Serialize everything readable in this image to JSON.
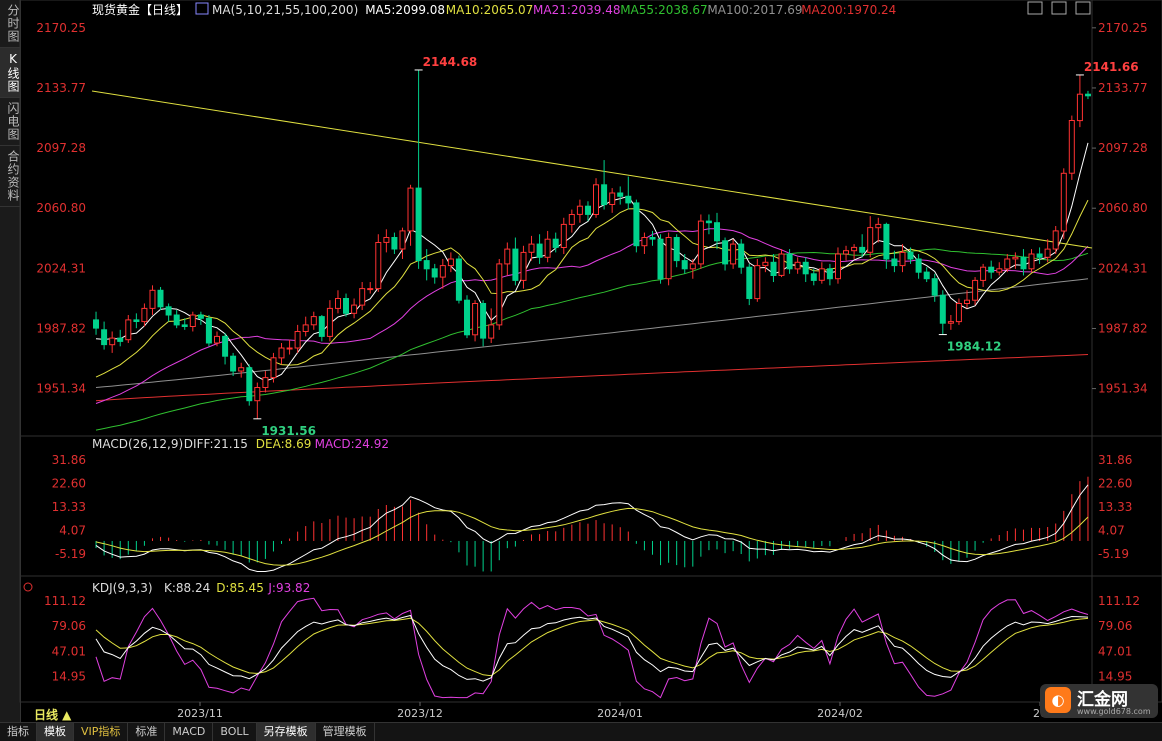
{
  "left_tabs": [
    "分时图",
    "K线图",
    "闪电图",
    "合约资料"
  ],
  "active_left_tab": 1,
  "bottom_tabs": [
    "指标",
    "模板",
    "VIP指标",
    "标准",
    "MACD",
    "BOLL",
    "另存模板",
    "管理模板"
  ],
  "period_label": "日线 ▲",
  "logo": {
    "glyph": "◐",
    "text": "汇金网",
    "sub": "www.gold678.com"
  },
  "colors": {
    "up": "#ff3232",
    "down": "#00d28c",
    "ma5": "#ffffff",
    "ma10": "#e0e040",
    "ma21": "#e040e0",
    "ma55": "#30c030",
    "ma100": "#909090",
    "ma200": "#e03030",
    "trend": "#e0e040"
  },
  "chart_data": {
    "type": "candlestick",
    "title": "现货黄金【日线】",
    "x_ticks": [
      "2023/11",
      "2023/12",
      "2024/01",
      "2024/02",
      "20"
    ],
    "main": {
      "ylim": [
        1925,
        2175
      ],
      "ticks": [
        "2170.25",
        "2133.77",
        "2097.28",
        "2060.80",
        "2024.31",
        "1987.82",
        "1951.34"
      ],
      "legend": [
        {
          "text": "MA(5,10,21,55,100,200)",
          "color": "#dddddd"
        },
        {
          "text": "MA5:2099.08",
          "color": "#ffffff"
        },
        {
          "text": "MA10:2065.07",
          "color": "#e0e040"
        },
        {
          "text": "MA21:2039.48",
          "color": "#e040e0"
        },
        {
          "text": "MA55:2038.67",
          "color": "#30c030"
        },
        {
          "text": "MA100:2017.69",
          "color": "#909090"
        },
        {
          "text": "MA200:1970.24",
          "color": "#e03030"
        }
      ],
      "candles": [
        [
          1993,
          1988,
          1998,
          1984
        ],
        [
          1987,
          1978,
          1992,
          1975
        ],
        [
          1978,
          1982,
          1986,
          1973
        ],
        [
          1982,
          1980,
          1987,
          1977
        ],
        [
          1981,
          1993,
          1996,
          1979
        ],
        [
          1993,
          1992,
          1997,
          1988
        ],
        [
          1992,
          2000,
          2003,
          1989
        ],
        [
          2000,
          2011,
          2014,
          1996
        ],
        [
          2011,
          2001,
          2013,
          1999
        ],
        [
          2001,
          1996,
          2003,
          1992
        ],
        [
          1996,
          1990,
          1999,
          1988
        ],
        [
          1990,
          1989,
          1994,
          1987
        ],
        [
          1989,
          1996,
          1998,
          1986
        ],
        [
          1996,
          1994,
          1998,
          1990
        ],
        [
          1994,
          1979,
          1996,
          1977
        ],
        [
          1979,
          1983,
          1986,
          1977
        ],
        [
          1983,
          1971,
          1985,
          1966
        ],
        [
          1971,
          1962,
          1973,
          1959
        ],
        [
          1962,
          1964,
          1967,
          1958
        ],
        [
          1964,
          1944,
          1966,
          1941
        ],
        [
          1944,
          1952,
          1955,
          1933
        ],
        [
          1952,
          1958,
          1962,
          1949
        ],
        [
          1958,
          1970,
          1973,
          1955
        ],
        [
          1970,
          1976,
          1979,
          1966
        ],
        [
          1976,
          1976,
          1981,
          1972
        ],
        [
          1976,
          1986,
          1990,
          1973
        ],
        [
          1986,
          1990,
          1995,
          1983
        ],
        [
          1990,
          1995,
          1998,
          1987
        ],
        [
          1995,
          1983,
          1996,
          1980
        ],
        [
          1983,
          2000,
          2005,
          1980
        ],
        [
          2000,
          2006,
          2011,
          1997
        ],
        [
          2006,
          1997,
          2009,
          1995
        ],
        [
          1997,
          2002,
          2006,
          1994
        ],
        [
          2002,
          2012,
          2016,
          1999
        ],
        [
          2012,
          2012,
          2016,
          2009
        ],
        [
          2012,
          2040,
          2045,
          2010
        ],
        [
          2040,
          2043,
          2048,
          2034
        ],
        [
          2043,
          2036,
          2046,
          2033
        ],
        [
          2036,
          2047,
          2049,
          2030
        ],
        [
          2047,
          2073,
          2075,
          2038
        ],
        [
          2073,
          2029,
          2144.68,
          2024
        ],
        [
          2029,
          2024,
          2036,
          2017
        ],
        [
          2024,
          2019,
          2027,
          2015
        ],
        [
          2019,
          2026,
          2030,
          2012
        ],
        [
          2026,
          2030,
          2034,
          2022
        ],
        [
          2030,
          2005,
          2032,
          2003
        ],
        [
          2005,
          1984,
          2008,
          1982
        ],
        [
          1984,
          2003,
          2005,
          1980
        ],
        [
          2003,
          1982,
          2005,
          1977
        ],
        [
          1982,
          1990,
          2000,
          1979
        ],
        [
          1990,
          2027,
          2030,
          1987
        ],
        [
          2027,
          2036,
          2040,
          2020
        ],
        [
          2036,
          2017,
          2043,
          2014
        ],
        [
          2017,
          2034,
          2038,
          2012
        ],
        [
          2034,
          2039,
          2044,
          2029
        ],
        [
          2039,
          2031,
          2045,
          2027
        ],
        [
          2031,
          2042,
          2047,
          2028
        ],
        [
          2042,
          2037,
          2046,
          2034
        ],
        [
          2037,
          2051,
          2055,
          2033
        ],
        [
          2051,
          2057,
          2060,
          2046
        ],
        [
          2057,
          2062,
          2066,
          2052
        ],
        [
          2062,
          2057,
          2065,
          2053
        ],
        [
          2057,
          2075,
          2079,
          2055
        ],
        [
          2075,
          2063,
          2090,
          2060
        ],
        [
          2063,
          2070,
          2073,
          2058
        ],
        [
          2070,
          2068,
          2074,
          2063
        ],
        [
          2068,
          2064,
          2080,
          2060
        ],
        [
          2064,
          2038,
          2066,
          2034
        ],
        [
          2038,
          2043,
          2046,
          2033
        ],
        [
          2043,
          2042,
          2047,
          2038
        ],
        [
          2042,
          2018,
          2045,
          2015
        ],
        [
          2018,
          2043,
          2046,
          2014
        ],
        [
          2043,
          2029,
          2045,
          2025
        ],
        [
          2029,
          2024,
          2033,
          2021
        ],
        [
          2024,
          2027,
          2030,
          2018
        ],
        [
          2027,
          2053,
          2057,
          2024
        ],
        [
          2053,
          2052,
          2057,
          2045
        ],
        [
          2052,
          2041,
          2058,
          2036
        ],
        [
          2041,
          2027,
          2043,
          2023
        ],
        [
          2027,
          2039,
          2042,
          2024
        ],
        [
          2039,
          2025,
          2042,
          2021
        ],
        [
          2025,
          2006,
          2027,
          2002
        ],
        [
          2006,
          2026,
          2030,
          2004
        ],
        [
          2026,
          2028,
          2031,
          2022
        ],
        [
          2028,
          2020,
          2033,
          2016
        ],
        [
          2020,
          2033,
          2036,
          2019
        ],
        [
          2033,
          2024,
          2036,
          2021
        ],
        [
          2024,
          2028,
          2031,
          2021
        ],
        [
          2028,
          2021,
          2031,
          2016
        ],
        [
          2021,
          2017,
          2024,
          2014
        ],
        [
          2017,
          2024,
          2028,
          2015
        ],
        [
          2024,
          2018,
          2027,
          2014
        ],
        [
          2018,
          2033,
          2037,
          2015
        ],
        [
          2033,
          2035,
          2038,
          2029
        ],
        [
          2035,
          2037,
          2039,
          2030
        ],
        [
          2037,
          2034,
          2045,
          2031
        ],
        [
          2034,
          2049,
          2056,
          2031
        ],
        [
          2049,
          2051,
          2055,
          2040
        ],
        [
          2051,
          2030,
          2052,
          2024
        ],
        [
          2030,
          2026,
          2035,
          2022
        ],
        [
          2026,
          2034,
          2039,
          2022
        ],
        [
          2034,
          2030,
          2037,
          2027
        ],
        [
          2030,
          2022,
          2033,
          2018
        ],
        [
          2022,
          2018,
          2025,
          2016
        ],
        [
          2018,
          2008,
          2021,
          2004
        ],
        [
          2008,
          1991,
          2011,
          1984.12
        ],
        [
          1991,
          1992,
          1996,
          1987
        ],
        [
          1992,
          2003,
          2006,
          1990
        ],
        [
          2003,
          2005,
          2011,
          2000
        ],
        [
          2005,
          2017,
          2019,
          2002
        ],
        [
          2017,
          2025,
          2027,
          2013
        ],
        [
          2025,
          2022,
          2029,
          2018
        ],
        [
          2022,
          2024,
          2028,
          2020
        ],
        [
          2024,
          2030,
          2033,
          2022
        ],
        [
          2030,
          2031,
          2034,
          2024
        ],
        [
          2031,
          2024,
          2036,
          2020
        ],
        [
          2024,
          2033,
          2036,
          2022
        ],
        [
          2033,
          2031,
          2037,
          2027
        ],
        [
          2031,
          2036,
          2042,
          2028
        ],
        [
          2036,
          2047,
          2050,
          2033
        ],
        [
          2047,
          2082,
          2085,
          2042
        ],
        [
          2082,
          2114,
          2117,
          2078
        ],
        [
          2114,
          2130,
          2141.66,
          2110
        ],
        [
          2130,
          2129,
          2132,
          2127
        ]
      ],
      "hi_label": "2144.68",
      "hi2_label": "2141.66",
      "lo_label": "1931.56",
      "lo2_label": "1984.12"
    },
    "macd": {
      "legend": [
        {
          "text": "MACD(26,12,9)",
          "color": "#dddddd"
        },
        {
          "text": "DIFF:21.15",
          "color": "#dddddd"
        },
        {
          "text": "DEA:8.69",
          "color": "#e0e040"
        },
        {
          "text": "MACD:24.92",
          "color": "#e040e0"
        }
      ],
      "ticks": [
        "31.86",
        "22.60",
        "13.33",
        "4.07",
        "-5.19"
      ],
      "ylim": [
        -13,
        35
      ]
    },
    "kdj": {
      "legend": [
        {
          "text": "KDJ(9,3,3)",
          "color": "#dddddd"
        },
        {
          "text": "K:88.24",
          "color": "#dddddd"
        },
        {
          "text": "D:85.45",
          "color": "#e0e040"
        },
        {
          "text": "J:93.82",
          "color": "#e040e0"
        }
      ],
      "ticks": [
        "111.12",
        "79.06",
        "47.01",
        "14.95"
      ],
      "ylim": [
        -15,
        120
      ]
    }
  }
}
